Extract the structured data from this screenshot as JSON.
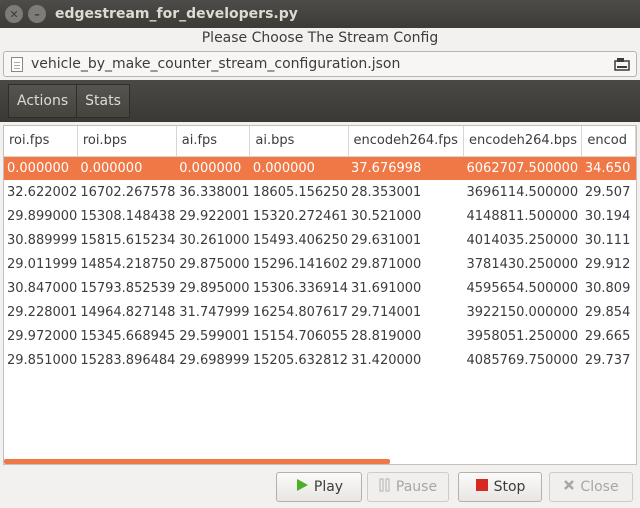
{
  "window": {
    "title": "edgestream_for_developers.py",
    "close_glyph": "✕",
    "min_glyph": "–"
  },
  "header": {
    "label": "Please Choose The Stream Config"
  },
  "file": {
    "name": "vehicle_by_make_counter_stream_configuration.json"
  },
  "toolbar": {
    "actions_label": "Actions",
    "stats_label": "Stats"
  },
  "table": {
    "columns": [
      "roi.fps",
      "roi.bps",
      "ai.fps",
      "ai.bps",
      "encodeh264.fps",
      "encodeh264.bps",
      "encod"
    ],
    "rows": [
      [
        "0.000000",
        "0.000000",
        "0.000000",
        "0.000000",
        "37.676998",
        "6062707.500000",
        "34.650"
      ],
      [
        "32.622002",
        "16702.267578",
        "36.338001",
        "18605.156250",
        "28.353001",
        "3696114.500000",
        "29.507"
      ],
      [
        "29.899000",
        "15308.148438",
        "29.922001",
        "15320.272461",
        "30.521000",
        "4148811.500000",
        "30.194"
      ],
      [
        "30.889999",
        "15815.615234",
        "30.261000",
        "15493.406250",
        "29.631001",
        "4014035.250000",
        "30.111"
      ],
      [
        "29.011999",
        "14854.218750",
        "29.875000",
        "15296.141602",
        "29.871000",
        "3781430.250000",
        "29.912"
      ],
      [
        "30.847000",
        "15793.852539",
        "29.895000",
        "15306.336914",
        "31.691000",
        "4595654.500000",
        "30.809"
      ],
      [
        "29.228001",
        "14964.827148",
        "31.747999",
        "16254.807617",
        "29.714001",
        "3922150.000000",
        "29.854"
      ],
      [
        "29.972000",
        "15345.668945",
        "29.599001",
        "15154.706055",
        "28.819000",
        "3958051.250000",
        "29.665"
      ],
      [
        "29.851000",
        "15283.896484",
        "29.698999",
        "15205.632812",
        "31.420000",
        "4085769.750000",
        "29.737"
      ]
    ],
    "selected_row": 0
  },
  "buttons": {
    "play": "Play",
    "pause": "Pause",
    "stop": "Stop",
    "close": "Close"
  },
  "colors": {
    "accent": "#f07746",
    "play_icon": "#4caf26",
    "stop_icon": "#d62a20"
  }
}
